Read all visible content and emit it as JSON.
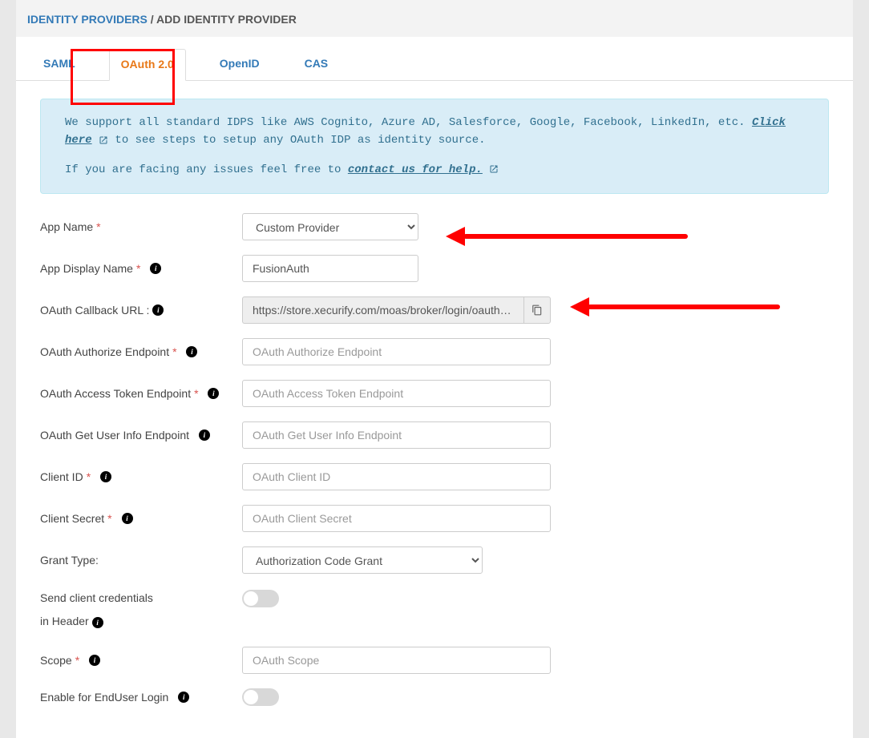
{
  "breadcrumb": {
    "link": "IDENTITY PROVIDERS",
    "sep": " / ",
    "current": "ADD IDENTITY PROVIDER"
  },
  "tabs": {
    "saml": "SAML",
    "oauth": "OAuth 2.0",
    "openid": "OpenID",
    "cas": "CAS"
  },
  "info": {
    "line1_prefix": "We support all standard IDPS like AWS Cognito, Azure AD, Salesforce, Google, Facebook, LinkedIn, etc. ",
    "click_here": "Click here",
    "line1_suffix": " to see steps to setup any OAuth IDP as identity source.",
    "line2_prefix": "If you are facing any issues feel free to ",
    "contact_link": "contact us for help."
  },
  "fields": {
    "app_name": {
      "label": "App Name",
      "value": "Custom Provider"
    },
    "app_display_name": {
      "label": "App Display Name",
      "value": "FusionAuth"
    },
    "callback": {
      "label": "OAuth Callback URL :",
      "value": "https://store.xecurify.com/moas/broker/login/oauth/callback"
    },
    "authorize": {
      "label": "OAuth Authorize Endpoint",
      "placeholder": "OAuth Authorize Endpoint"
    },
    "token": {
      "label": "OAuth Access Token Endpoint",
      "placeholder": "OAuth Access Token Endpoint"
    },
    "userinfo": {
      "label": "OAuth Get User Info Endpoint",
      "placeholder": "OAuth Get User Info Endpoint"
    },
    "client_id": {
      "label": "Client ID",
      "placeholder": "OAuth Client ID"
    },
    "client_secret": {
      "label": "Client Secret",
      "placeholder": "OAuth Client Secret"
    },
    "grant_type": {
      "label": "Grant Type:",
      "value": "Authorization Code Grant"
    },
    "send_header": {
      "label1": "Send client credentials",
      "label2": "in Header"
    },
    "scope": {
      "label": "Scope",
      "placeholder": "OAuth Scope"
    },
    "enable_enduser": {
      "label": "Enable for EndUser Login"
    }
  }
}
